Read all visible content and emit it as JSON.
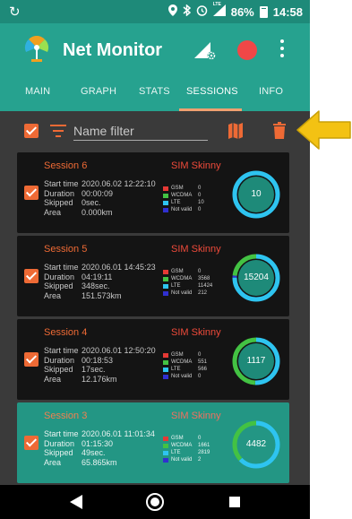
{
  "status_bar": {
    "sync_icon": "sync-icon",
    "battery": "86%",
    "time": "14:58",
    "network_label": "LTE"
  },
  "toolbar": {
    "title": "Net Monitor",
    "logo_icon": "antenna-logo-icon",
    "signal_settings_icon": "signal-settings-icon",
    "record_icon": "record-icon",
    "more_icon": "more-vert-icon",
    "accent_color": "#26a28f"
  },
  "tabs": [
    {
      "label": "MAIN"
    },
    {
      "label": "GRAPH"
    },
    {
      "label": "STATS"
    },
    {
      "label": "SESSIONS",
      "active": true
    },
    {
      "label": "INFO"
    }
  ],
  "filter": {
    "placeholder": "Name filter",
    "value": "",
    "select_all_checked": true,
    "filter_icon": "filter-icon",
    "map_icon": "map-icon",
    "delete_icon": "trash-icon"
  },
  "annotation": {
    "arrow_icon": "arrow-icon",
    "color": "#f3c213"
  },
  "labels": {
    "start_time": "Start time",
    "duration": "Duration",
    "skipped": "Skipped",
    "area": "Area",
    "gsm": "GSM",
    "wcdma": "WCDMA",
    "lte": "LTE",
    "not_valid": "Not valid"
  },
  "legend_colors": {
    "gsm": "#e53935",
    "wcdma": "#43c243",
    "lte": "#2ec4f0",
    "not_valid": "#3030d0"
  },
  "sessions": [
    {
      "name": "Session 6",
      "sim": "SIM Skinny",
      "start_time": "2020.06.02 12:22:10",
      "duration": "00:00:09",
      "skipped": "0sec.",
      "area": "0.000km",
      "gsm": "0",
      "wcdma": "0",
      "lte": "10",
      "not_valid": "0",
      "total": "10",
      "checked": true,
      "selected": false
    },
    {
      "name": "Session 5",
      "sim": "SIM Skinny",
      "start_time": "2020.06.01 14:45:23",
      "duration": "04:19:11",
      "skipped": "348sec.",
      "area": "151.573km",
      "gsm": "0",
      "wcdma": "3568",
      "lte": "11424",
      "not_valid": "212",
      "total": "15204",
      "checked": true,
      "selected": false
    },
    {
      "name": "Session 4",
      "sim": "SIM Skinny",
      "start_time": "2020.06.01 12:50:20",
      "duration": "00:18:53",
      "skipped": "17sec.",
      "area": "12.176km",
      "gsm": "0",
      "wcdma": "551",
      "lte": "566",
      "not_valid": "0",
      "total": "1117",
      "checked": true,
      "selected": false
    },
    {
      "name": "Session 3",
      "sim": "SIM Skinny",
      "start_time": "2020.06.01 11:01:34",
      "duration": "01:15:30",
      "skipped": "49sec.",
      "area": "65.865km",
      "gsm": "0",
      "wcdma": "1661",
      "lte": "2819",
      "not_valid": "2",
      "total": "4482",
      "checked": true,
      "selected": true
    }
  ],
  "nav_bar": {
    "back_icon": "back-icon",
    "home_icon": "home-icon",
    "recents_icon": "recents-icon"
  }
}
